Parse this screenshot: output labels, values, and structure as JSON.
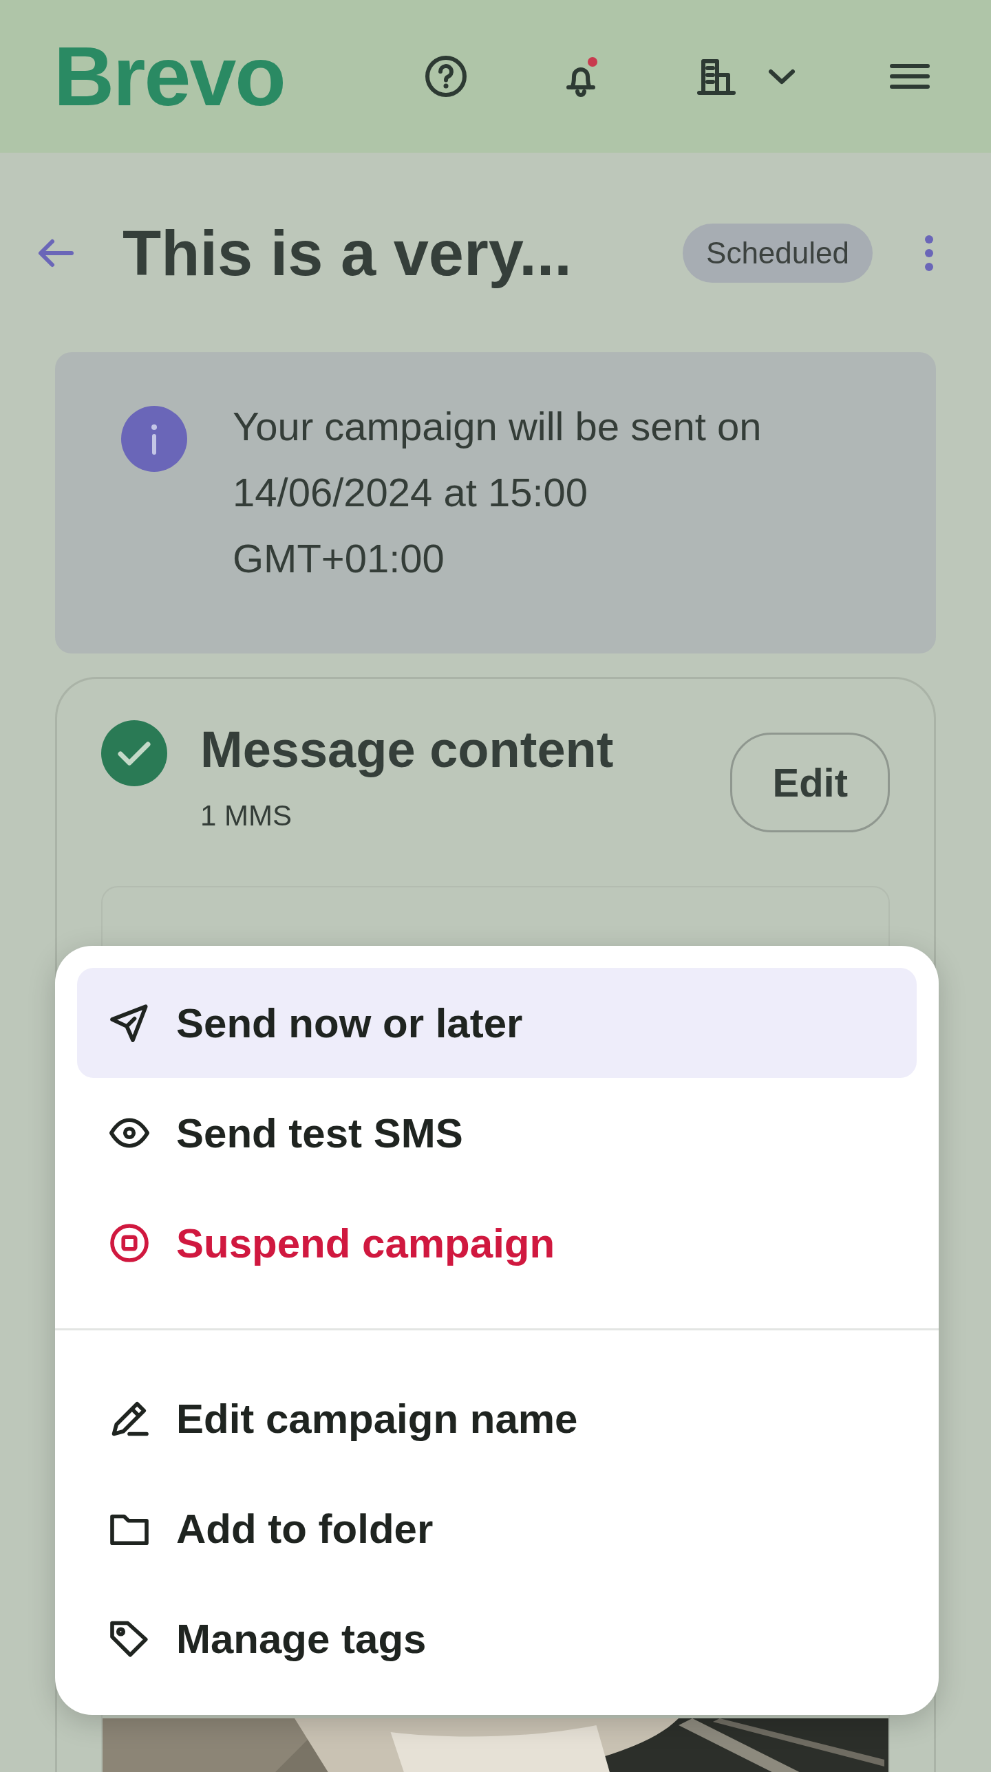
{
  "header": {
    "logo": "Brevo",
    "notification_unread": true
  },
  "page": {
    "title": "This is a very...",
    "status": "Scheduled"
  },
  "info": {
    "message_lines": [
      "Your campaign will be sent on",
      "14/06/2024 at 15:00",
      "GMT+01:00"
    ]
  },
  "content_card": {
    "complete": true,
    "title": "Message content",
    "subtitle": "1 MMS",
    "edit_button": "Edit"
  },
  "menu": {
    "groups": [
      [
        {
          "label": "Send now or later",
          "kind": "send",
          "color": "#1f2420",
          "selected": true
        },
        {
          "label": "Send test SMS",
          "kind": "preview",
          "color": "#1f2420",
          "selected": false
        },
        {
          "label": "Suspend campaign",
          "kind": "suspend",
          "color": "#d0183f",
          "selected": false
        }
      ],
      [
        {
          "label": "Edit campaign name",
          "kind": "rename",
          "color": "#1f2420",
          "selected": false
        },
        {
          "label": "Add to folder",
          "kind": "folder",
          "color": "#1f2420",
          "selected": false
        },
        {
          "label": "Manage tags",
          "kind": "tags",
          "color": "#1f2420",
          "selected": false
        }
      ]
    ]
  }
}
